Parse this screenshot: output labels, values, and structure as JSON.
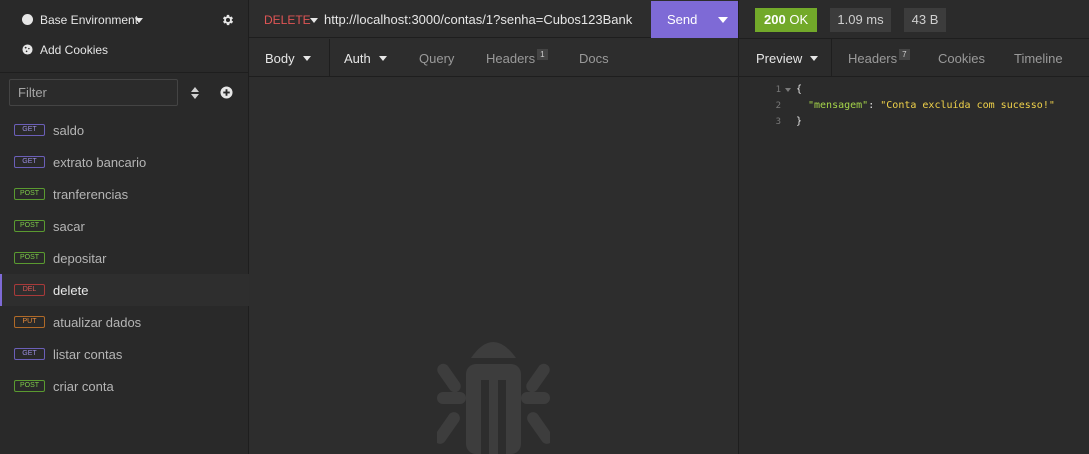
{
  "sidebar": {
    "environment_label": "Base Environment",
    "cookies_label": "Add Cookies",
    "filter_placeholder": "Filter",
    "requests": [
      {
        "method": "GET",
        "name": "saldo",
        "active": false
      },
      {
        "method": "GET",
        "name": "extrato bancario",
        "active": false
      },
      {
        "method": "POST",
        "name": "tranferencias",
        "active": false
      },
      {
        "method": "POST",
        "name": "sacar",
        "active": false
      },
      {
        "method": "POST",
        "name": "depositar",
        "active": false
      },
      {
        "method": "DEL",
        "name": "delete",
        "active": true
      },
      {
        "method": "PUT",
        "name": "atualizar dados",
        "active": false
      },
      {
        "method": "GET",
        "name": "listar contas",
        "active": false
      },
      {
        "method": "POST",
        "name": "criar conta",
        "active": false
      }
    ]
  },
  "request": {
    "method": "DELETE",
    "url": "http://localhost:3000/contas/1?senha=Cubos123Bank",
    "send_label": "Send",
    "tabs": {
      "body": "Body",
      "auth": "Auth",
      "query": "Query",
      "headers": "Headers",
      "headers_count": "1",
      "docs": "Docs"
    }
  },
  "response": {
    "status_code": "200",
    "status_text": "OK",
    "time": "1.09 ms",
    "size": "43 B",
    "tabs": {
      "preview": "Preview",
      "headers": "Headers",
      "headers_count": "7",
      "cookies": "Cookies",
      "timeline": "Timeline"
    },
    "body_lines": [
      {
        "num": "1",
        "open": "{"
      },
      {
        "num": "2",
        "key": "\"mensagem\"",
        "sep": ": ",
        "value": "\"Conta excluída com sucesso!\""
      },
      {
        "num": "3",
        "close": "}"
      }
    ]
  },
  "colors": {
    "accent": "#7e6ad6",
    "status_ok": "#72a92a",
    "method_delete": "#e05555",
    "method_get": "#9b8ee0",
    "method_post": "#7ec94a",
    "method_put": "#e58a3a",
    "json_key": "#a6d64a",
    "json_string": "#f0d24a"
  },
  "icons": {
    "settings": "gear-icon",
    "cookies": "cookie-icon",
    "sort": "sort-icon",
    "add": "plus-circle-icon",
    "empty_state": "bug-icon"
  }
}
